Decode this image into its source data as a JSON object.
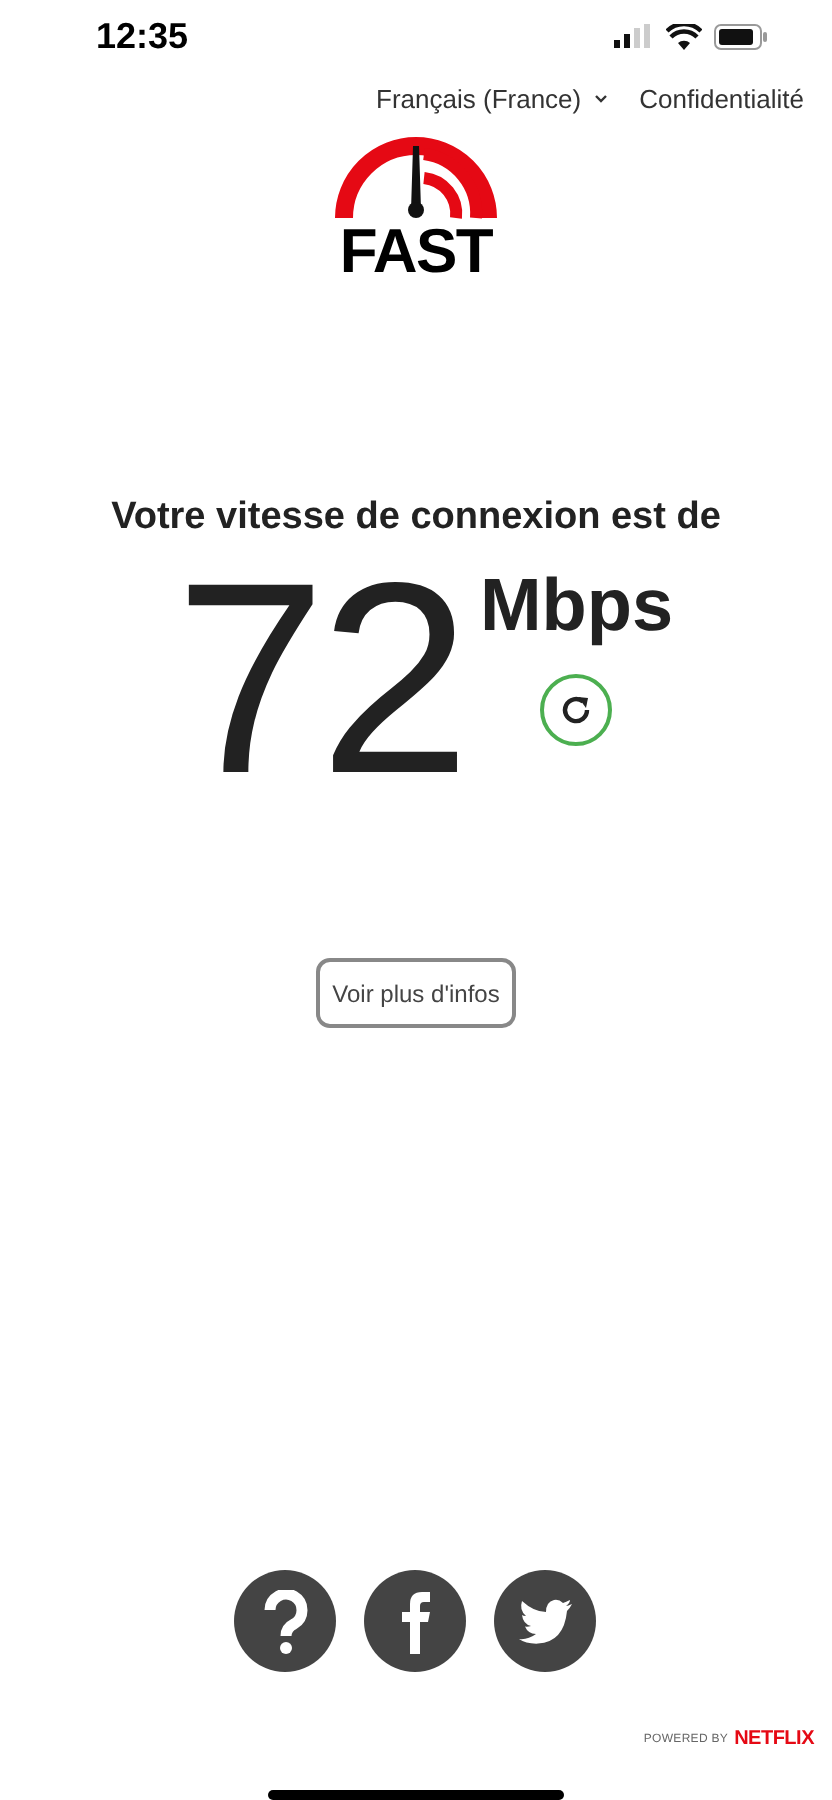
{
  "status_bar": {
    "time": "12:35"
  },
  "header": {
    "language": "Français (France)",
    "privacy": "Confidentialité"
  },
  "logo": {
    "text": "FAST"
  },
  "result": {
    "heading": "Votre vitesse de connexion est de",
    "speed": "72",
    "unit": "Mbps"
  },
  "more_info_button": "Voir plus d'infos",
  "footer": {
    "powered_by": "POWERED BY",
    "brand": "NETFLIX"
  }
}
